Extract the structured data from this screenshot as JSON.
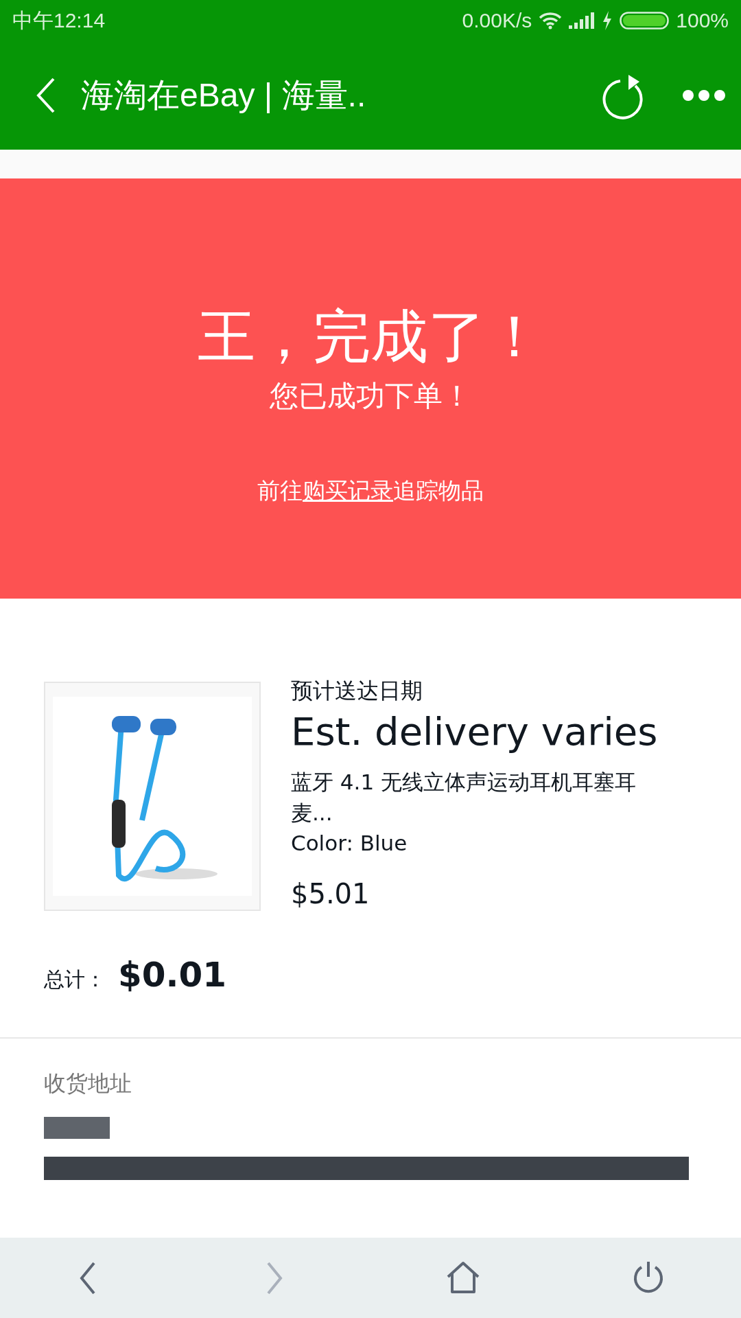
{
  "status_bar": {
    "time": "中午12:14",
    "speed": "0.00K/s",
    "battery": "100%"
  },
  "toolbar": {
    "title": "海淘在eBay | 海量.."
  },
  "banner": {
    "title": "王，完成了！",
    "subtitle": "您已成功下单！",
    "link_before": "前往",
    "link": "购买记录",
    "link_after": "追踪物品"
  },
  "order_item": {
    "delivery_label": "预计送达日期",
    "delivery": "Est. delivery varies",
    "name": "蓝牙 4.1 无线立体声运动耳机耳塞耳麦...",
    "variant": "Color: Blue",
    "price": "$5.01"
  },
  "total": {
    "label": "总计：",
    "value": "$0.01"
  },
  "address": {
    "label": "收货地址"
  },
  "bottom_nav": [
    {
      "kind": "back",
      "disabled": false
    },
    {
      "kind": "forward",
      "disabled": true
    },
    {
      "kind": "home",
      "disabled": false
    },
    {
      "kind": "power",
      "disabled": false
    }
  ]
}
